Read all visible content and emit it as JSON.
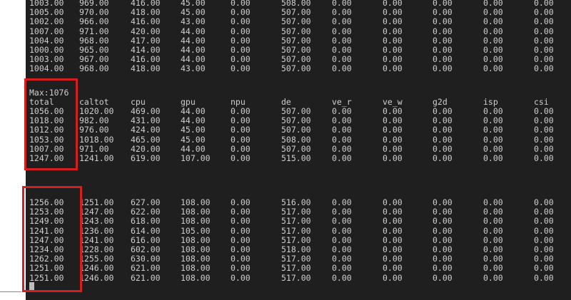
{
  "terminal": {
    "rows_top": [
      [
        "1003.00",
        "969.00",
        "416.00",
        "45.00",
        "0.00",
        "508.00",
        "0.00",
        "0.00",
        "0.00",
        "0.00",
        "0.00"
      ],
      [
        "1005.00",
        "970.00",
        "418.00",
        "45.00",
        "0.00",
        "507.00",
        "0.00",
        "0.00",
        "0.00",
        "0.00",
        "0.00"
      ],
      [
        "1002.00",
        "966.00",
        "416.00",
        "43.00",
        "0.00",
        "507.00",
        "0.00",
        "0.00",
        "0.00",
        "0.00",
        "0.00"
      ],
      [
        "1007.00",
        "971.00",
        "420.00",
        "44.00",
        "0.00",
        "507.00",
        "0.00",
        "0.00",
        "0.00",
        "0.00",
        "0.00"
      ],
      [
        "1004.00",
        "968.00",
        "417.00",
        "44.00",
        "0.00",
        "507.00",
        "0.00",
        "0.00",
        "0.00",
        "0.00",
        "0.00"
      ],
      [
        "1000.00",
        "965.00",
        "414.00",
        "44.00",
        "0.00",
        "507.00",
        "0.00",
        "0.00",
        "0.00",
        "0.00",
        "0.00"
      ],
      [
        "1003.00",
        "967.00",
        "416.00",
        "44.00",
        "0.00",
        "507.00",
        "0.00",
        "0.00",
        "0.00",
        "0.00",
        "0.00"
      ],
      [
        "1004.00",
        "968.00",
        "418.00",
        "43.00",
        "0.00",
        "507.00",
        "0.00",
        "0.00",
        "0.00",
        "0.00",
        "0.00"
      ]
    ],
    "max_line": "Max:1076",
    "headers": [
      "total",
      "caltot",
      "cpu",
      "gpu",
      "npu",
      "de",
      "ve_r",
      "ve_w",
      "g2d",
      "isp",
      "csi"
    ],
    "rows_mid": [
      [
        "1056.00",
        "1020.00",
        "469.00",
        "44.00",
        "0.00",
        "507.00",
        "0.00",
        "0.00",
        "0.00",
        "0.00",
        "0.00"
      ],
      [
        "1018.00",
        "982.00",
        "431.00",
        "44.00",
        "0.00",
        "507.00",
        "0.00",
        "0.00",
        "0.00",
        "0.00",
        "0.00"
      ],
      [
        "1012.00",
        "976.00",
        "424.00",
        "45.00",
        "0.00",
        "507.00",
        "0.00",
        "0.00",
        "0.00",
        "0.00",
        "0.00"
      ],
      [
        "1053.00",
        "1018.00",
        "465.00",
        "45.00",
        "0.00",
        "508.00",
        "0.00",
        "0.00",
        "0.00",
        "0.00",
        "0.00"
      ],
      [
        "1007.00",
        "971.00",
        "420.00",
        "44.00",
        "0.00",
        "507.00",
        "0.00",
        "0.00",
        "0.00",
        "0.00",
        "0.00"
      ],
      [
        "1247.00",
        "1241.00",
        "619.00",
        "107.00",
        "0.00",
        "515.00",
        "0.00",
        "0.00",
        "0.00",
        "0.00",
        "0.00"
      ]
    ],
    "rows_bottom": [
      [
        "1256.00",
        "1251.00",
        "627.00",
        "108.00",
        "0.00",
        "516.00",
        "0.00",
        "0.00",
        "0.00",
        "0.00",
        "0.00"
      ],
      [
        "1253.00",
        "1247.00",
        "622.00",
        "108.00",
        "0.00",
        "517.00",
        "0.00",
        "0.00",
        "0.00",
        "0.00",
        "0.00"
      ],
      [
        "1249.00",
        "1243.00",
        "618.00",
        "108.00",
        "0.00",
        "517.00",
        "0.00",
        "0.00",
        "0.00",
        "0.00",
        "0.00"
      ],
      [
        "1241.00",
        "1236.00",
        "614.00",
        "105.00",
        "0.00",
        "517.00",
        "0.00",
        "0.00",
        "0.00",
        "0.00",
        "0.00"
      ],
      [
        "1247.00",
        "1241.00",
        "616.00",
        "108.00",
        "0.00",
        "517.00",
        "0.00",
        "0.00",
        "0.00",
        "0.00",
        "0.00"
      ],
      [
        "1234.00",
        "1228.00",
        "602.00",
        "108.00",
        "0.00",
        "518.00",
        "0.00",
        "0.00",
        "0.00",
        "0.00",
        "0.00"
      ],
      [
        "1262.00",
        "1255.00",
        "630.00",
        "108.00",
        "0.00",
        "517.00",
        "0.00",
        "0.00",
        "0.00",
        "0.00",
        "0.00"
      ],
      [
        "1251.00",
        "1246.00",
        "621.00",
        "108.00",
        "0.00",
        "517.00",
        "0.00",
        "0.00",
        "0.00",
        "0.00",
        "0.00"
      ],
      [
        "1251.00",
        "1246.00",
        "621.00",
        "108.00",
        "0.00",
        "517.00",
        "0.00",
        "0.00",
        "0.00",
        "0.00",
        "0.00"
      ]
    ]
  },
  "colors": {
    "terminal_bg": "#1f1f1f",
    "terminal_text": "#cfcfcf",
    "highlight_box": "#d51f1f"
  }
}
